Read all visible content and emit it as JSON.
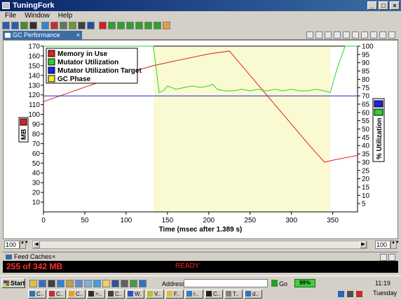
{
  "window": {
    "title": "TuningFork",
    "controls": [
      "_",
      "□",
      "×"
    ]
  },
  "menu": [
    "File",
    "Window",
    "Help"
  ],
  "toolbar": {
    "buttons": [
      {
        "icon": "save-icon",
        "color": "#2a5ab8"
      },
      {
        "icon": "save-all-icon",
        "color": "#2a5ab8"
      },
      {
        "icon": "chart-icon",
        "color": "#4a8a30"
      },
      {
        "icon": "gear-icon",
        "color": "#303030"
      },
      {
        "icon": "globe-icon",
        "color": "#2a8ad0"
      },
      {
        "icon": "palette-icon",
        "color": "#c03030"
      },
      {
        "icon": "table-icon",
        "color": "#5a7a5a"
      },
      {
        "icon": "grid-icon",
        "color": "#6a9a30"
      },
      {
        "icon": "filter-icon",
        "color": "#404040"
      },
      {
        "icon": "monitor-icon",
        "color": "#2050a0"
      },
      {
        "icon": "record-icon",
        "color": "#d02020"
      },
      {
        "icon": "skip-start-icon",
        "color": "#30a030"
      },
      {
        "icon": "step-back-icon",
        "color": "#30a030"
      },
      {
        "icon": "rewind-icon",
        "color": "#30a030"
      },
      {
        "icon": "play-icon",
        "color": "#30a030"
      },
      {
        "icon": "step-forward-icon",
        "color": "#30a030"
      },
      {
        "icon": "skip-end-icon",
        "color": "#30a030"
      },
      {
        "icon": "clear-icon",
        "color": "#e0a040"
      }
    ]
  },
  "editor_tab": {
    "label": "GC Performance Summary",
    "close": "×"
  },
  "view_icons": [
    "view-icon-1",
    "view-icon-2",
    "view-icon-3",
    "view-icon-4",
    "view-icon-5",
    "view-icon-6",
    "view-icon-7",
    "view-icon-8",
    "view-icon-9",
    "view-icon-10"
  ],
  "chart_data": {
    "type": "line",
    "xlabel": "Time (msec after 1.389 s)",
    "ylabel_left": "MB",
    "ylabel_right": "% Utilization",
    "xlim": [
      0,
      380
    ],
    "ylim_left": [
      0,
      170
    ],
    "ylim_right": [
      0,
      100
    ],
    "xticks": [
      0,
      50,
      100,
      150,
      200,
      250,
      300,
      350
    ],
    "yticks_left": [
      10,
      20,
      30,
      40,
      50,
      60,
      70,
      80,
      90,
      100,
      110,
      120,
      130,
      140,
      150,
      160,
      170
    ],
    "yticks_right": [
      5,
      10,
      15,
      20,
      25,
      30,
      35,
      40,
      45,
      50,
      55,
      60,
      65,
      70,
      75,
      80,
      85,
      90,
      95,
      100
    ],
    "legend_position": "top-left",
    "grid": false,
    "legend": [
      {
        "name": "Memory in Use",
        "color": "#e02020"
      },
      {
        "name": "Mutator Utilization",
        "color": "#30d030"
      },
      {
        "name": "Mutator Utilization Target",
        "color": "#2020e0"
      },
      {
        "name": "GC Phase",
        "color": "#f0f020"
      }
    ],
    "gc_phase": [
      [
        133,
        347
      ]
    ],
    "series": [
      {
        "name": "Memory in Use",
        "axis": "left",
        "color": "#e02020",
        "x": [
          0,
          50,
          100,
          133,
          160,
          200,
          225,
          230,
          260,
          290,
          320,
          340,
          350,
          380
        ],
        "y": [
          113,
          128,
          142,
          150,
          155,
          162,
          165,
          160,
          130,
          100,
          70,
          51,
          53,
          58
        ]
      },
      {
        "name": "Mutator Utilization",
        "axis": "right",
        "color": "#30d030",
        "x": [
          0,
          133,
          140,
          145,
          150,
          160,
          170,
          180,
          190,
          200,
          205,
          210,
          220,
          230,
          240,
          250,
          260,
          270,
          280,
          290,
          300,
          310,
          320,
          330,
          340,
          347,
          355,
          365,
          380
        ],
        "y": [
          100,
          100,
          72,
          73,
          76,
          74,
          75,
          76,
          75,
          76,
          77,
          74,
          73,
          73,
          74,
          73,
          74,
          73,
          74,
          73,
          74,
          73,
          73,
          74,
          73,
          72,
          86,
          100,
          100
        ]
      },
      {
        "name": "Mutator Utilization Target",
        "axis": "right",
        "color": "#2020e0",
        "x": [
          0,
          380
        ],
        "y": [
          70,
          70
        ]
      }
    ]
  },
  "left_scroller": {
    "value": "100",
    "arrows": "▲▼"
  },
  "right_scroller": {
    "value": "100",
    "arrows": "▲▼"
  },
  "scroll_arrows": {
    "left": "◀",
    "right": "▶"
  },
  "feed_view": {
    "label": "Feed Caches",
    "close": "×"
  },
  "status": {
    "memory": "255 of 342 MB",
    "ready": "READY"
  },
  "taskbar": {
    "start": "Start",
    "address_label": "Address",
    "go_label": "Go",
    "battery": "99%",
    "time": "11:19",
    "day": "Tuesday",
    "items": [
      "C..",
      "C..",
      "C..",
      ">..",
      "C..",
      "W.",
      "V..",
      "F..",
      "r..",
      "C..",
      "T..",
      "d.."
    ]
  }
}
